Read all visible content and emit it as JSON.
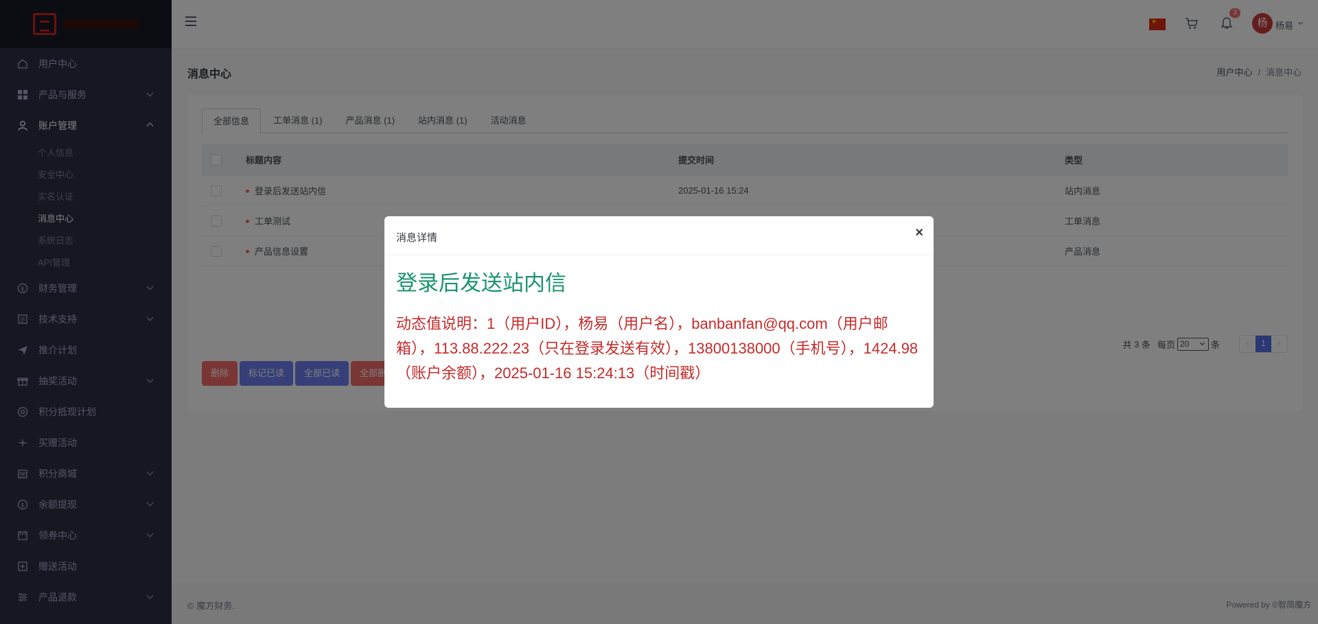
{
  "sidebar": {
    "items": [
      {
        "label": "用户中心",
        "icon": "home-icon",
        "has_chevron": false
      },
      {
        "label": "产品与服务",
        "icon": "grid-icon",
        "has_chevron": true
      },
      {
        "label": "账户管理",
        "icon": "user-icon",
        "has_chevron": true,
        "expanded": true
      },
      {
        "label": "财务管理",
        "icon": "dollar-icon",
        "has_chevron": true
      },
      {
        "label": "技术支持",
        "icon": "document-icon",
        "has_chevron": true
      },
      {
        "label": "推介计划",
        "icon": "send-icon",
        "has_chevron": false
      },
      {
        "label": "抽奖活动",
        "icon": "gift-icon",
        "has_chevron": true
      },
      {
        "label": "积分抵现计划",
        "icon": "target-icon",
        "has_chevron": false
      },
      {
        "label": "买赠活动",
        "icon": "move-icon",
        "has_chevron": false
      },
      {
        "label": "积分商城",
        "icon": "store-icon",
        "has_chevron": true
      },
      {
        "label": "余额提现",
        "icon": "dollar-icon",
        "has_chevron": true
      },
      {
        "label": "领券中心",
        "icon": "calendar-icon",
        "has_chevron": true
      },
      {
        "label": "赠送活动",
        "icon": "plus-box-icon",
        "has_chevron": false
      },
      {
        "label": "产品退款",
        "icon": "sliders-icon",
        "has_chevron": true
      }
    ],
    "sub_items": [
      "个人信息",
      "安全中心",
      "实名认证",
      "消息中心",
      "系统日志",
      "API管理"
    ],
    "current_sub": "消息中心"
  },
  "topbar": {
    "notification_count": "3",
    "avatar_initial": "杨",
    "username": "杨易"
  },
  "page": {
    "title": "消息中心",
    "breadcrumb": [
      "用户中心",
      "消息中心"
    ]
  },
  "tabs": [
    "全部信息",
    "工单消息 (1)",
    "产品消息 (1)",
    "站内消息 (1)",
    "活动消息"
  ],
  "table": {
    "headers": [
      "标题内容",
      "提交时间",
      "类型"
    ],
    "rows": [
      {
        "title": "登录后发送站内信",
        "time": "2025-01-16 15:24",
        "type": "站内消息"
      },
      {
        "title": "工单测试",
        "time": "",
        "type": "工单消息"
      },
      {
        "title": "产品信息设置",
        "time": "",
        "type": "产品消息"
      }
    ]
  },
  "pagination": {
    "total_prefix": "共",
    "total": "3",
    "total_suffix": "条",
    "per_page_label": "每页",
    "per_page": "20",
    "per_page_suffix": "条",
    "prev": "‹",
    "current_page": "1",
    "next": "›"
  },
  "actions": {
    "delete": "删除",
    "mark_read": "标记已读",
    "all_read": "全部已读",
    "all_delete": "全部删"
  },
  "footer": {
    "left": "© 魔方财务.",
    "right": "Powered by ©智简魔方"
  },
  "modal": {
    "title": "消息详情",
    "close": "×",
    "message_title": "登录后发送站内信",
    "message_content": "动态值说明：1（用户ID），杨易（用户名），banbanfan@qq.com（用户邮箱），113.88.222.23（只在登录发送有效），13800138000（手机号），1424.98（账户余额），2025-01-16 15:24:13（时间戳）"
  },
  "colors": {
    "sidebar_bg": "#2a3042",
    "accent": "#556ee6",
    "danger": "#f46a6a",
    "message_title": "#1a9470",
    "message_content": "#c52b2b"
  }
}
